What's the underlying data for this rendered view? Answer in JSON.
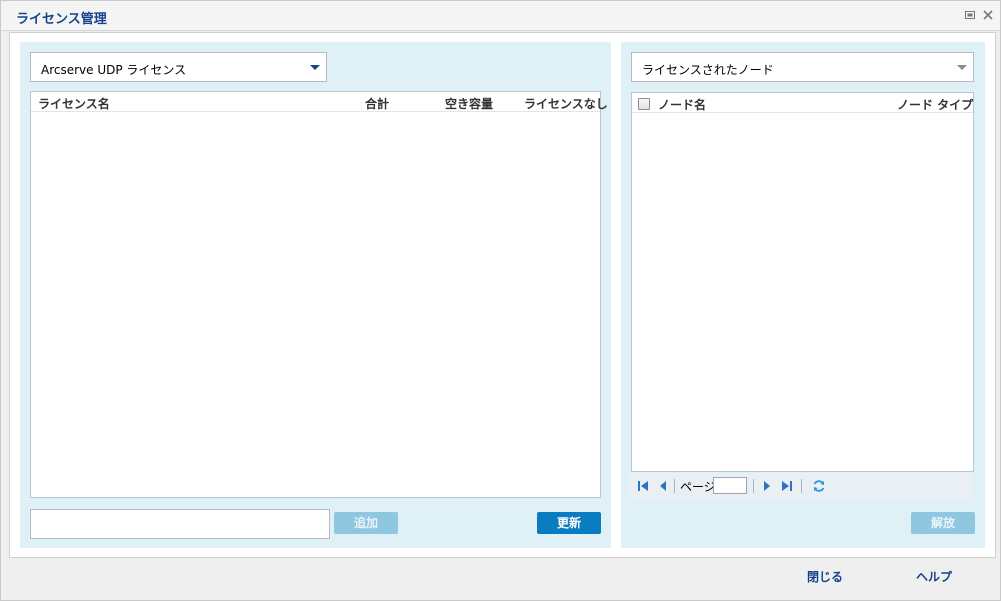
{
  "window": {
    "title": "ライセンス管理",
    "restore_icon": "restore-window-icon",
    "close_icon": "close-icon"
  },
  "left_panel": {
    "product_select": {
      "selected": "Arcserve UDP ライセンス"
    },
    "license_grid": {
      "columns": [
        "ライセンス名",
        "合計",
        "空き容量",
        "ライセンスなし"
      ],
      "rows": []
    },
    "license_key_input": {
      "value": ""
    },
    "add_button": "追加",
    "update_button": "更新"
  },
  "right_panel": {
    "node_filter_select": {
      "selected": "ライセンスされたノード"
    },
    "node_grid": {
      "columns": [
        "ノード名",
        "ノード タイプ"
      ],
      "rows": []
    },
    "pager": {
      "page_label": "ページ",
      "page_value": ""
    },
    "release_button": "解放"
  },
  "footer": {
    "close_link": "閉じる",
    "help_link": "ヘルプ"
  },
  "colors": {
    "accent": "#15428b",
    "panel_bg": "#dff0f6",
    "primary_button": "#0a7cc1",
    "disabled_button": "#8fc7e0"
  }
}
